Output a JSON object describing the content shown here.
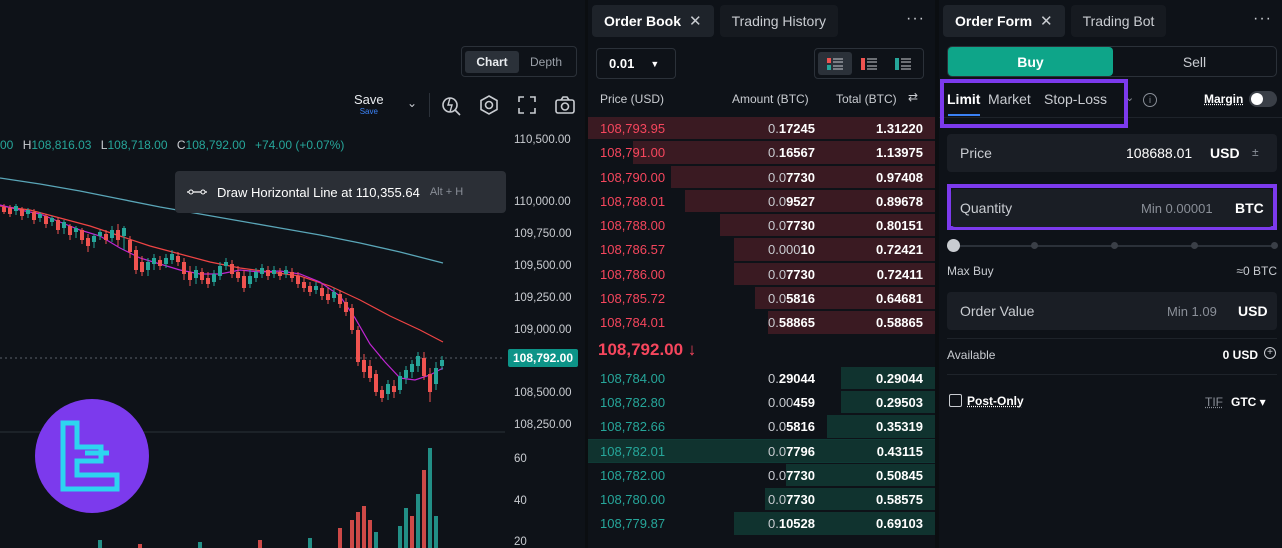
{
  "chart": {
    "view_tabs": [
      "Chart",
      "Depth"
    ],
    "toolbar": {
      "save_label": "Save",
      "save_sub": "Save"
    },
    "ohlc": {
      "o_val": "00",
      "h_key": "H",
      "h_val": "108,816.03",
      "l_key": "L",
      "l_val": "108,718.00",
      "c_key": "C",
      "c_val": "108,792.00",
      "change": "+74.00 (+0.07%)"
    },
    "tooltip": {
      "text": "Draw Horizontal Line at 110,355.64",
      "shortcut": "Alt + H"
    },
    "price_axis": [
      "110,500.00",
      "110,000.00",
      "109,750.00",
      "109,500.00",
      "109,250.00",
      "109,000.00",
      "108,500.00",
      "108,250.00"
    ],
    "current_price": "108,792.00",
    "volume_axis": [
      "60",
      "40",
      "20"
    ],
    "colors": {
      "up": "#26a69a",
      "down": "#ef5350",
      "ma_fast": "#c026d3",
      "ma_mid": "#ef4444",
      "ma_slow": "#5aa6b8"
    }
  },
  "orderbook": {
    "tabs": [
      {
        "label": "Order Book",
        "close": "✕"
      },
      {
        "label": "Trading History"
      }
    ],
    "more": "···",
    "precision": "0.01",
    "headers": {
      "price": "Price (USD)",
      "amount": "Amount (BTC)",
      "total": "Total (BTC)"
    },
    "asks": [
      {
        "price": "108,793.95",
        "amt_a": "0.",
        "amt_b": "17245",
        "total": "1.31220",
        "depth": 1.0
      },
      {
        "price": "108,791.00",
        "amt_a": "0.",
        "amt_b": "16567",
        "total": "1.13975",
        "depth": 0.87
      },
      {
        "price": "108,790.00",
        "amt_a": "0.0",
        "amt_b": "7730",
        "total": "0.97408",
        "depth": 0.76
      },
      {
        "price": "108,788.01",
        "amt_a": "0.0",
        "amt_b": "9527",
        "total": "0.89678",
        "depth": 0.72
      },
      {
        "price": "108,788.00",
        "amt_a": "0.0",
        "amt_b": "7730",
        "total": "0.80151",
        "depth": 0.62
      },
      {
        "price": "108,786.57",
        "amt_a": "0.000",
        "amt_b": "10",
        "total": "0.72421",
        "depth": 0.58
      },
      {
        "price": "108,786.00",
        "amt_a": "0.0",
        "amt_b": "7730",
        "total": "0.72411",
        "depth": 0.58
      },
      {
        "price": "108,785.72",
        "amt_a": "0.0",
        "amt_b": "5816",
        "total": "0.64681",
        "depth": 0.52
      },
      {
        "price": "108,784.01",
        "amt_a": "0.",
        "amt_b": "58865",
        "total": "0.58865",
        "depth": 0.48
      }
    ],
    "mid_price": "108,792.00 ↓",
    "bids": [
      {
        "price": "108,784.00",
        "amt_a": "0.",
        "amt_b": "29044",
        "total": "0.29044",
        "depth": 0.27
      },
      {
        "price": "108,782.80",
        "amt_a": "0.00",
        "amt_b": "459",
        "total": "0.29503",
        "depth": 0.27
      },
      {
        "price": "108,782.66",
        "amt_a": "0.0",
        "amt_b": "5816",
        "total": "0.35319",
        "depth": 0.31
      },
      {
        "price": "108,782.01",
        "amt_a": "0.0",
        "amt_b": "7796",
        "total": "0.43115",
        "depth": 1.0,
        "highlight": true
      },
      {
        "price": "108,782.00",
        "amt_a": "0.0",
        "amt_b": "7730",
        "total": "0.50845",
        "depth": 0.43
      },
      {
        "price": "108,780.00",
        "amt_a": "0.0",
        "amt_b": "7730",
        "total": "0.58575",
        "depth": 0.49
      },
      {
        "price": "108,779.87",
        "amt_a": "0.",
        "amt_b": "10528",
        "total": "0.69103",
        "depth": 0.58
      }
    ]
  },
  "orderform": {
    "tabs": [
      {
        "label": "Order Form",
        "close": "✕"
      },
      {
        "label": "Trading Bot"
      }
    ],
    "more": "···",
    "buy_label": "Buy",
    "sell_label": "Sell",
    "order_types": [
      "Limit",
      "Market",
      "Stop-Loss"
    ],
    "margin_label": "Margin",
    "price": {
      "label": "Price",
      "value": "108688.01",
      "unit": "USD",
      "sym": "±"
    },
    "quantity": {
      "label": "Quantity",
      "placeholder": "Min 0.00001",
      "unit": "BTC"
    },
    "max_buy": {
      "label": "Max Buy",
      "value": "≈0 BTC"
    },
    "order_value": {
      "label": "Order Value",
      "placeholder": "Min 1.09",
      "unit": "USD"
    },
    "available": {
      "label": "Available",
      "value": "0 USD"
    },
    "post_only": "Post-Only",
    "tif_label": "TIF",
    "tif_value": "GTC"
  }
}
